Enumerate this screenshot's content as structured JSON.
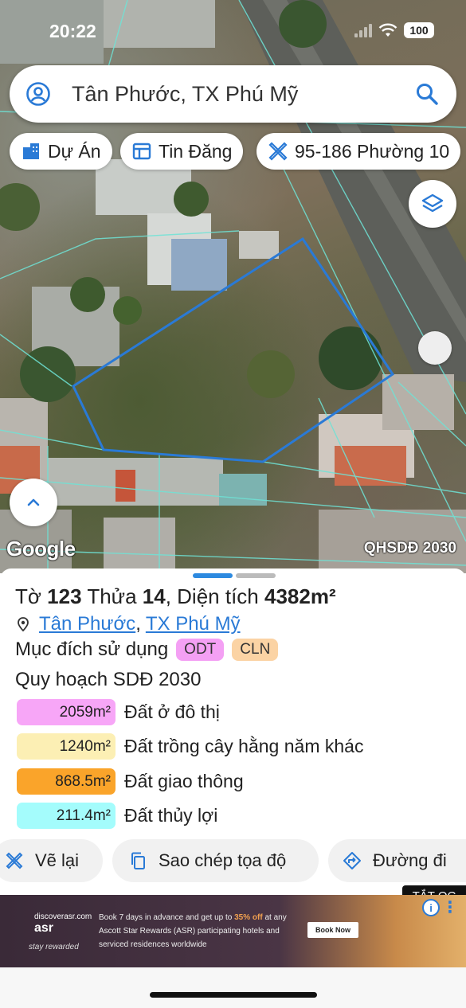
{
  "status_bar": {
    "time": "20:22",
    "battery": "100"
  },
  "search": {
    "title": "Tân Phước, TX Phú Mỹ"
  },
  "chips": [
    {
      "label": "Dự Án",
      "icon": "building-icon"
    },
    {
      "label": "Tin Đăng",
      "icon": "listing-icon"
    },
    {
      "label": "95-186 Phường 10",
      "icon": "ruler-icon"
    }
  ],
  "map": {
    "attribution": "Google",
    "layer_label": "QHSDĐ 2030",
    "parcel_outline_color": "#2a7ad6"
  },
  "parcel": {
    "sheet_label": "Tờ",
    "sheet_no": "123",
    "plot_label": "Thửa",
    "plot_no": "14",
    "area_label": ", Diện tích",
    "area_value": "4382m²",
    "ward": "Tân Phước",
    "town": "TX Phú Mỹ"
  },
  "usage": {
    "label": "Mục đích sử dụng",
    "badges": [
      {
        "code": "ODT",
        "color": "#f4a0f4"
      },
      {
        "code": "CLN",
        "color": "#fbd3a4"
      }
    ]
  },
  "plan": {
    "title": "Quy hoạch SDĐ 2030",
    "rows": [
      {
        "area": "2059m²",
        "label": "Đất ở đô thị",
        "color": "#f7a6f7"
      },
      {
        "area": "1240m²",
        "label": "Đất trồng cây hằng năm khác",
        "color": "#fcefb4"
      },
      {
        "area": "868.5m²",
        "label": "Đất giao thông",
        "color": "#faa42a"
      },
      {
        "area": "211.4m²",
        "label": "Đất thủy lợi",
        "color": "#a4fcfc"
      }
    ]
  },
  "actions": {
    "redraw": "Vẽ lại",
    "copy": "Sao chép tọa độ",
    "directions": "Đường đi"
  },
  "ad": {
    "close_label": "TẮT QC",
    "brand": "asr",
    "brand_small": "discoverasr.com",
    "tagline": "stay rewarded",
    "message_pre": "Book 7 days in advance and get up to",
    "message_highlight": "35% off",
    "message_post": "at any Ascott Star Rewards (ASR) participating hotels and serviced residences worldwide",
    "cta": "Book Now",
    "info": "i"
  }
}
